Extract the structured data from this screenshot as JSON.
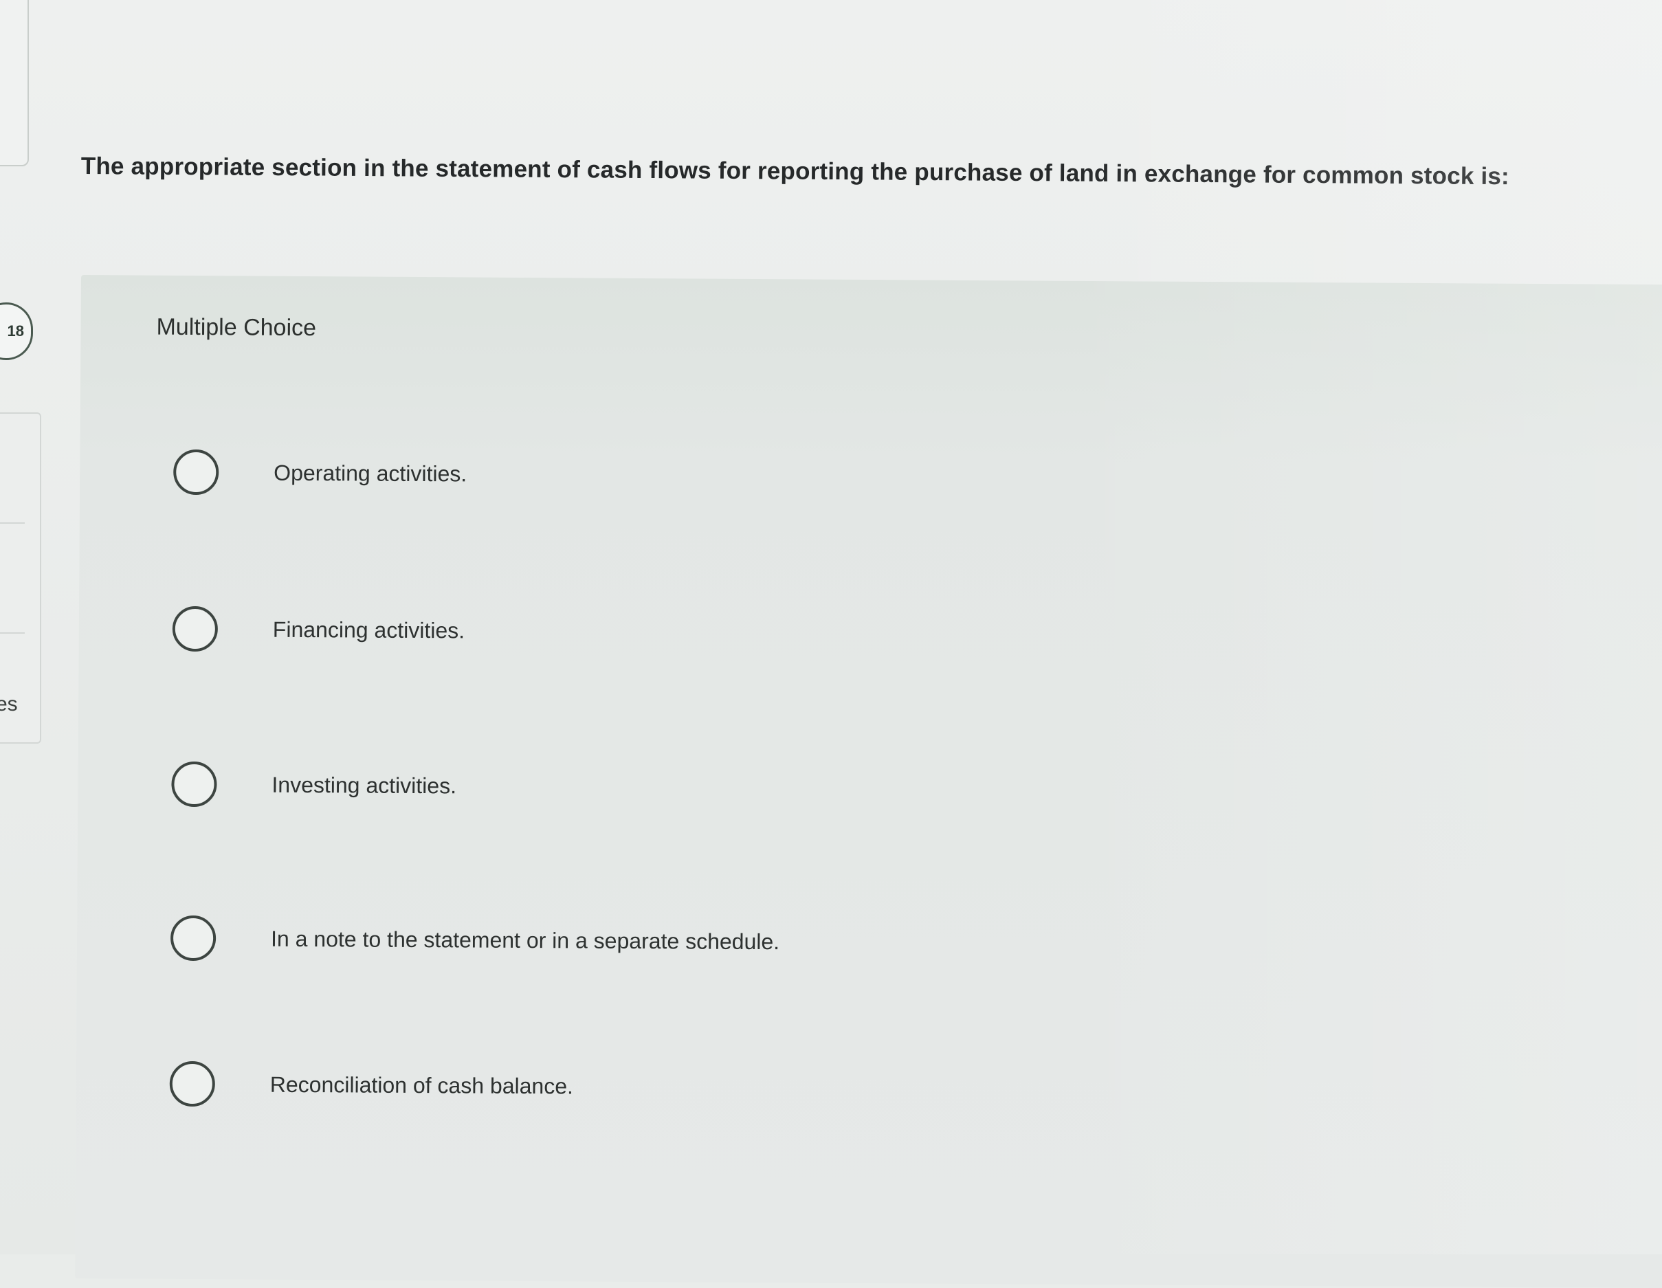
{
  "sidebar": {
    "question_number": "18",
    "label_fragment": "es"
  },
  "question": {
    "text": "The appropriate section in the statement of cash flows for reporting the purchase of land in exchange for common stock is:"
  },
  "answer_panel": {
    "type_label": "Multiple Choice",
    "options": [
      {
        "label": "Operating activities."
      },
      {
        "label": "Financing activities."
      },
      {
        "label": "Investing activities."
      },
      {
        "label": "In a note to the statement or in a separate schedule."
      },
      {
        "label": "Reconciliation of cash balance."
      }
    ]
  },
  "colors": {
    "page_background": "#e9ecea",
    "panel_background": "#e3e7e5",
    "text": "#2a2d2c",
    "radio_border": "#3d4541"
  }
}
